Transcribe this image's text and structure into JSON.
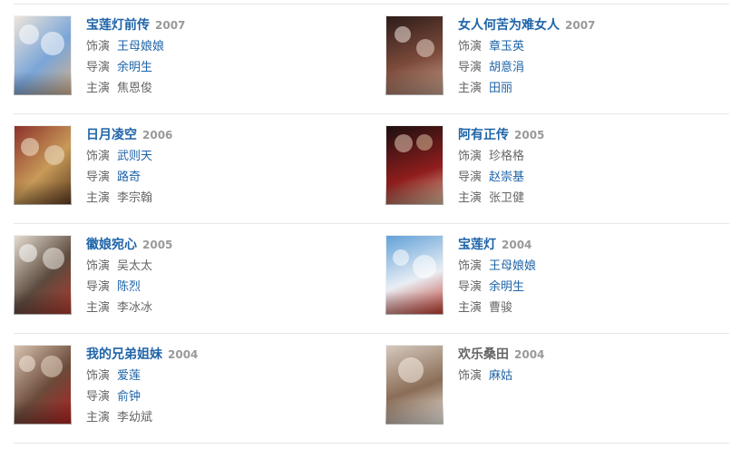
{
  "items": [
    {
      "title": "宝莲灯前传",
      "year": "2007",
      "title_link": true,
      "roles": [
        {
          "label": "饰演",
          "value": "王母娘娘",
          "link": true
        },
        {
          "label": "导演",
          "value": "余明生",
          "link": true
        },
        {
          "label": "主演",
          "value": "焦恩俊",
          "link": false
        }
      ],
      "poster_colors": [
        "#f0e6da",
        "#7aa5d8",
        "#d7b28a"
      ]
    },
    {
      "title": "女人何苦为难女人",
      "year": "2007",
      "title_link": true,
      "roles": [
        {
          "label": "饰演",
          "value": "章玉英",
          "link": true
        },
        {
          "label": "导演",
          "value": "胡意涓",
          "link": true
        },
        {
          "label": "主演",
          "value": "田丽",
          "link": true
        }
      ],
      "poster_colors": [
        "#2b1b18",
        "#7c4a3b",
        "#c9a38d"
      ]
    },
    {
      "title": "日月凌空",
      "year": "2006",
      "title_link": true,
      "roles": [
        {
          "label": "饰演",
          "value": "武则天",
          "link": true
        },
        {
          "label": "导演",
          "value": "路奇",
          "link": true
        },
        {
          "label": "主演",
          "value": "李宗翰",
          "link": false
        }
      ],
      "poster_colors": [
        "#8b2f2a",
        "#c89a58",
        "#5a3a1f"
      ]
    },
    {
      "title": "阿有正传",
      "year": "2005",
      "title_link": true,
      "roles": [
        {
          "label": "饰演",
          "value": "珍格格",
          "link": false
        },
        {
          "label": "导演",
          "value": "赵崇基",
          "link": true
        },
        {
          "label": "主演",
          "value": "张卫健",
          "link": false
        }
      ],
      "poster_colors": [
        "#1a0f0f",
        "#8f1d1d",
        "#d9b99a"
      ]
    },
    {
      "title": "徽娘宛心",
      "year": "2005",
      "title_link": true,
      "roles": [
        {
          "label": "饰演",
          "value": "吴太太",
          "link": false
        },
        {
          "label": "导演",
          "value": "陈烈",
          "link": true
        },
        {
          "label": "主演",
          "value": "李冰冰",
          "link": false
        }
      ],
      "poster_colors": [
        "#e8e0d3",
        "#5c4a3e",
        "#b23a2e"
      ]
    },
    {
      "title": "宝莲灯",
      "year": "2004",
      "title_link": true,
      "roles": [
        {
          "label": "饰演",
          "value": "王母娘娘",
          "link": true
        },
        {
          "label": "导演",
          "value": "余明生",
          "link": true
        },
        {
          "label": "主演",
          "value": "曹骏",
          "link": false
        }
      ],
      "poster_colors": [
        "#5f9fd8",
        "#e9eef4",
        "#c0392b"
      ]
    },
    {
      "title": "我的兄弟姐妹",
      "year": "2004",
      "title_link": true,
      "roles": [
        {
          "label": "饰演",
          "value": "爱莲",
          "link": true
        },
        {
          "label": "导演",
          "value": "俞钟",
          "link": true
        },
        {
          "label": "主演",
          "value": "李幼斌",
          "link": false
        }
      ],
      "poster_colors": [
        "#d9c6b2",
        "#6b4a3a",
        "#b22222"
      ]
    },
    {
      "title": "欢乐桑田",
      "year": "2004",
      "title_link": false,
      "roles": [
        {
          "label": "饰演",
          "value": "麻姑",
          "link": true
        }
      ],
      "poster_colors": [
        "#d7cbbf",
        "#8a6d57",
        "#f2ede6"
      ]
    }
  ]
}
